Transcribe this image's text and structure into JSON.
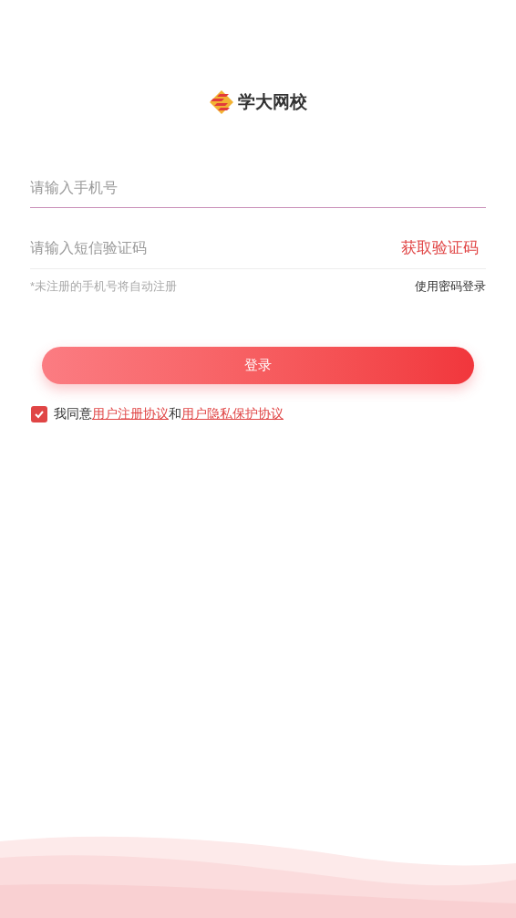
{
  "logo": {
    "text": "学大网校"
  },
  "phone_field": {
    "placeholder": "请输入手机号"
  },
  "code_field": {
    "placeholder": "请输入短信验证码"
  },
  "get_code_button": "获取验证码",
  "hint": "*未注册的手机号将自动注册",
  "password_login_link": "使用密码登录",
  "login_button": "登录",
  "agreement": {
    "checked": true,
    "prefix": "我同意",
    "link_1": "用户注册协议",
    "joiner": "和",
    "link_2": "用户隐私保护协议"
  }
}
